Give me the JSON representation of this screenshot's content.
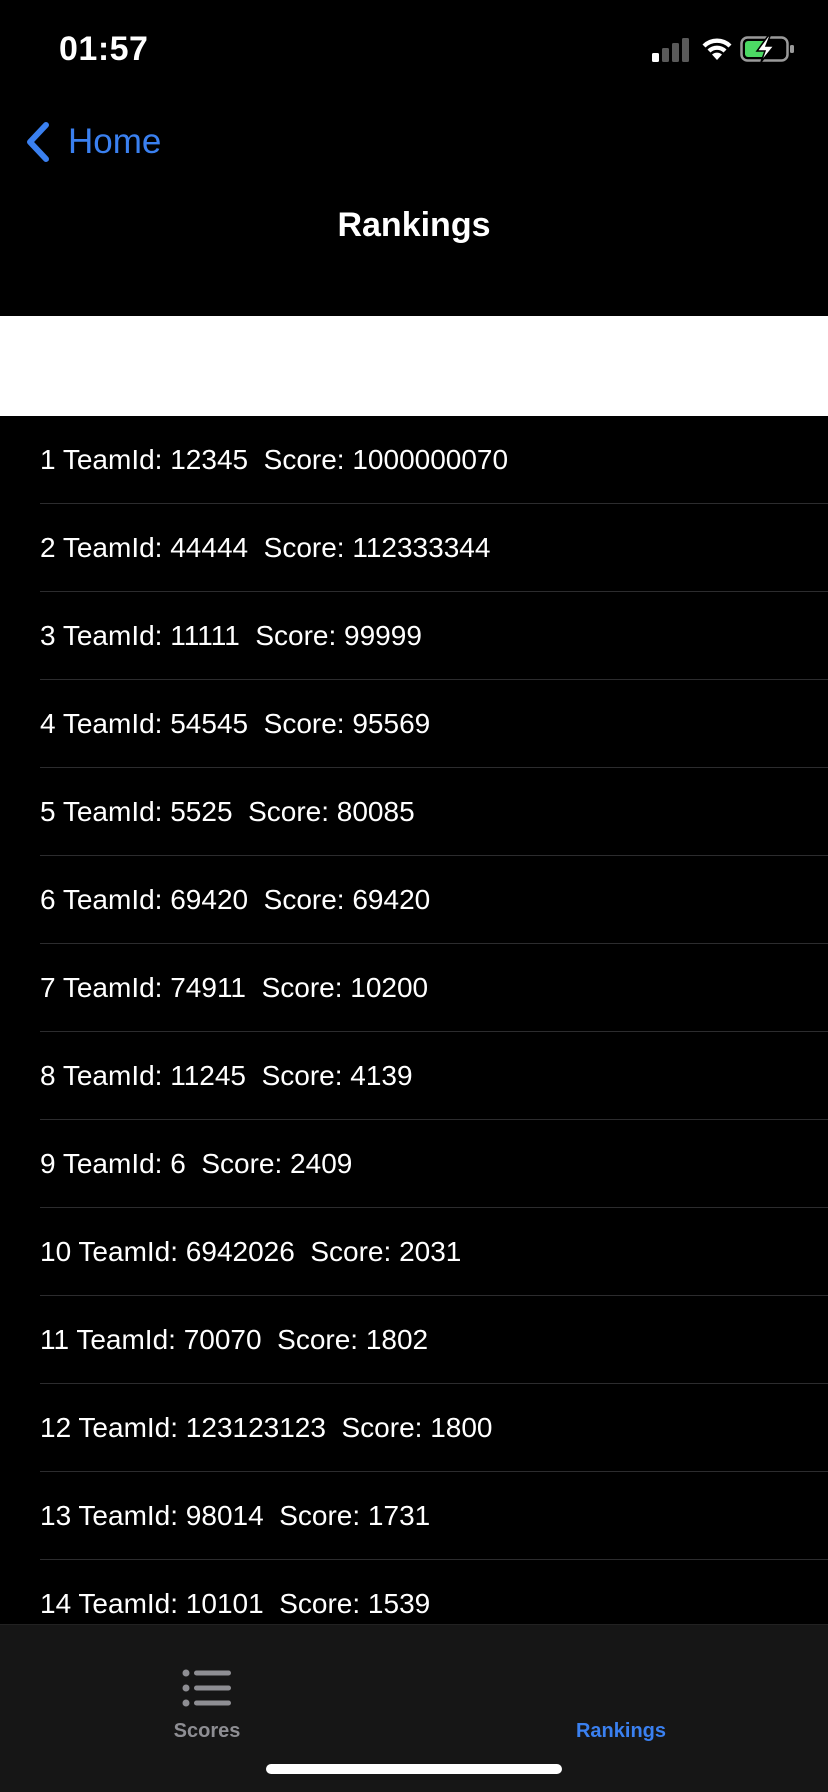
{
  "status_bar": {
    "time": "01:57",
    "icons": [
      "cellular-signal-icon",
      "wifi-icon",
      "battery-charging-icon"
    ],
    "battery_color": "#4cd964"
  },
  "nav": {
    "back_label": "Home",
    "title": "Rankings",
    "accent_color": "#3a80f0"
  },
  "rankings": [
    "1 TeamId: 12345  Score: 1000000070",
    "2 TeamId: 44444  Score: 112333344",
    "3 TeamId: 11111  Score: 99999",
    "4 TeamId: 54545  Score: 95569",
    "5 TeamId: 5525  Score: 80085",
    "6 TeamId: 69420  Score: 69420",
    "7 TeamId: 74911  Score: 10200",
    "8 TeamId: 11245  Score: 4139",
    "9 TeamId: 6  Score: 2409",
    "10 TeamId: 6942026  Score: 2031",
    "11 TeamId: 70070  Score: 1802",
    "12 TeamId: 123123123  Score: 1800",
    "13 TeamId: 98014  Score: 1731",
    "14 TeamId: 10101  Score: 1539"
  ],
  "tab_bar": {
    "tabs": [
      {
        "label": "Scores",
        "icon": "list-icon",
        "selected": false
      },
      {
        "label": "Rankings",
        "icon": "",
        "selected": true
      }
    ]
  }
}
